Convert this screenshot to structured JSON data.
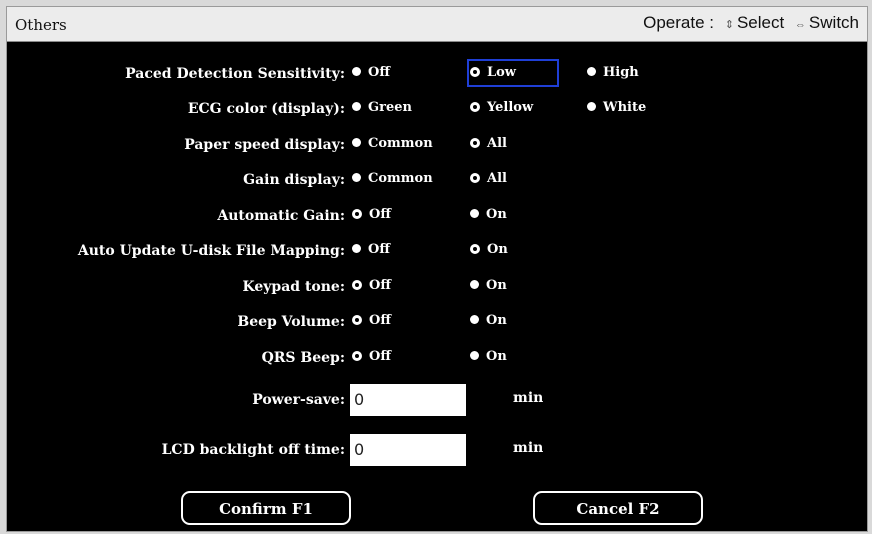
{
  "header": {
    "title": "Others",
    "operate_label": "Operate :",
    "select_icon": "up-down-arrows-icon",
    "select_label": "Select",
    "switch_icon": "left-right-arrows-icon",
    "switch_label": "Switch"
  },
  "settings": [
    {
      "label": "Paced Detection Sensitivity:",
      "options": [
        "Off",
        "Low",
        "High"
      ],
      "selected": "Low"
    },
    {
      "label": "ECG color (display):",
      "options": [
        "Green",
        "Yellow",
        "White"
      ],
      "selected": "Yellow"
    },
    {
      "label": "Paper speed display:",
      "options": [
        "Common",
        "All"
      ],
      "selected": "All"
    },
    {
      "label": "Gain display:",
      "options": [
        "Common",
        "All"
      ],
      "selected": "All"
    },
    {
      "label": "Automatic Gain:",
      "options": [
        "Off",
        "On"
      ],
      "selected": "Off"
    },
    {
      "label": "Auto Update U-disk File Mapping:",
      "options": [
        "Off",
        "On"
      ],
      "selected": "On"
    },
    {
      "label": "Keypad tone:",
      "options": [
        "Off",
        "On"
      ],
      "selected": "Off"
    },
    {
      "label": "Beep Volume:",
      "options": [
        "Off",
        "On"
      ],
      "selected": "Off"
    },
    {
      "label": "QRS Beep:",
      "options": [
        "Off",
        "On"
      ],
      "selected": "Off"
    }
  ],
  "power_save": {
    "label": "Power-save:",
    "value": "0",
    "unit": "min"
  },
  "lcd_backlight": {
    "label": "LCD backlight off time:",
    "value": "0",
    "unit": "min"
  },
  "buttons": {
    "confirm": "Confirm F1",
    "cancel": "Cancel F2"
  }
}
